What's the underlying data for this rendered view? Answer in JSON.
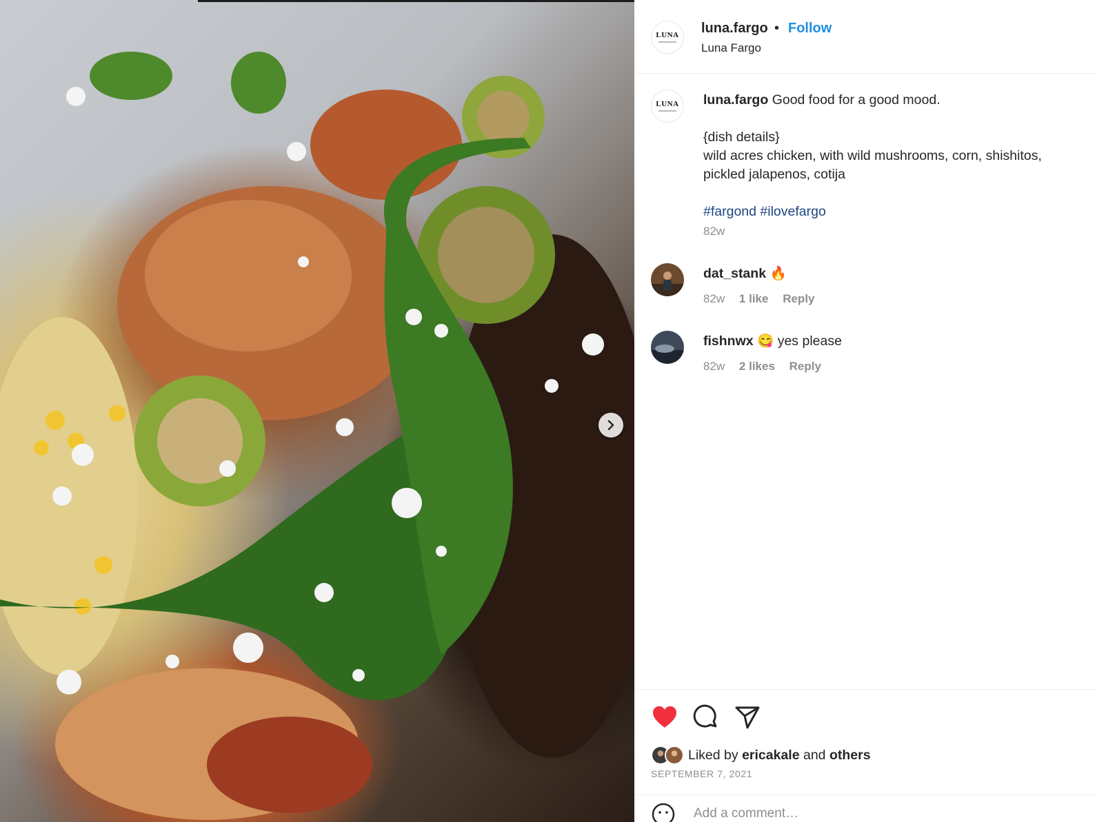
{
  "post": {
    "account": {
      "username": "luna.fargo",
      "separator": "•",
      "follow_label": "Follow",
      "location": "Luna Fargo",
      "logo_text": "LUNA"
    },
    "caption": {
      "username": "luna.fargo",
      "lines": [
        "Good food for a good mood.",
        "",
        "{dish details}",
        "wild acres chicken, with wild mushrooms, corn, shishitos,",
        "pickled jalapenos, cotija",
        "",
        "#fargond #ilovefargo"
      ],
      "time": "82w"
    },
    "comments": [
      {
        "username": "dat_stank",
        "text": "🔥",
        "time": "82w",
        "likes": "1 like",
        "reply_label": "Reply"
      },
      {
        "username": "fishnwx",
        "text": "😋 yes please",
        "time": "82w",
        "likes": "2 likes",
        "reply_label": "Reply"
      }
    ],
    "likes": {
      "prefix": "Liked by",
      "user": "ericakale",
      "middle": "and",
      "others": "others"
    },
    "date": "SEPTEMBER 7, 2021",
    "add_comment_placeholder": "Add a comment…"
  },
  "icons": {
    "like": "heart-icon",
    "comment": "comment-icon",
    "share": "paper-plane-icon",
    "next": "chevron-right-icon",
    "emoji": "smiley-icon"
  },
  "colors": {
    "follow": "#1d8fe1",
    "hashtag": "#1c4680",
    "liked_heart": "#f0303e",
    "muted": "#8e8e8e"
  }
}
